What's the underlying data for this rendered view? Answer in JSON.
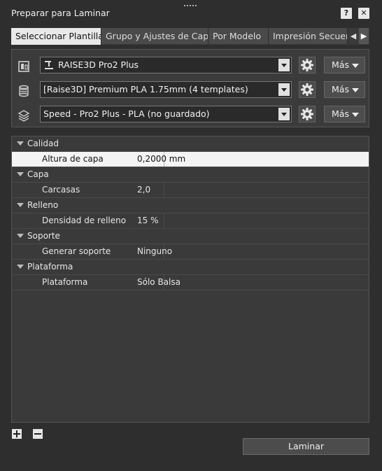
{
  "window": {
    "title": "Preparar para Laminar",
    "help_label": "?",
    "close_label": "✕"
  },
  "tabs": [
    {
      "label": "Seleccionar Plantilla"
    },
    {
      "label": "Grupo y Ajustes de Capa"
    },
    {
      "label": "Por Modelo"
    },
    {
      "label": "Impresión Secuencial"
    }
  ],
  "selectors": [
    {
      "icon": "printer-icon",
      "value": "RAISE3D Pro2 Plus",
      "more_label": "Más"
    },
    {
      "icon": "filament-spool-icon",
      "value": "[Raise3D] Premium PLA 1.75mm (4 templates)",
      "more_label": "Más"
    },
    {
      "icon": "layers-icon",
      "value": "Speed - Pro2 Plus - PLA (no guardado)",
      "more_label": "Más"
    }
  ],
  "settings": [
    {
      "category": "Calidad",
      "props": [
        {
          "key": "Altura de capa",
          "value": "0,2000 mm",
          "selected": true
        }
      ]
    },
    {
      "category": "Capa",
      "props": [
        {
          "key": "Carcasas",
          "value": "2,0"
        }
      ]
    },
    {
      "category": "Relleno",
      "props": [
        {
          "key": "Densidad de relleno",
          "value": "15 %"
        }
      ]
    },
    {
      "category": "Soporte",
      "props": [
        {
          "key": "Generar soporte",
          "value": "Ninguno"
        }
      ]
    },
    {
      "category": "Plataforma",
      "props": [
        {
          "key": "Plataforma",
          "value": "Sólo Balsa"
        }
      ]
    }
  ],
  "footer": {
    "add_label": "+",
    "remove_label": "−",
    "slice_label": "Laminar"
  }
}
